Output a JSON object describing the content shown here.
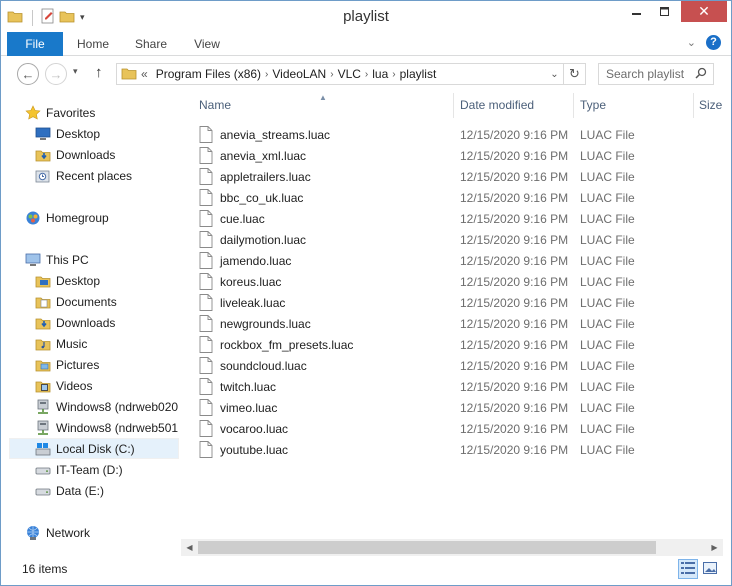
{
  "window": {
    "title": "playlist"
  },
  "ribbon": {
    "tabs": [
      "File",
      "Home",
      "Share",
      "View"
    ]
  },
  "navbar": {
    "breadcrumb_prefix": "«",
    "breadcrumbs": [
      "Program Files (x86)",
      "VideoLAN",
      "VLC",
      "lua",
      "playlist"
    ],
    "search_placeholder": "Search playlist"
  },
  "navpane": {
    "items": [
      {
        "label": "Favorites",
        "icon": "star-icon",
        "level": 0
      },
      {
        "label": "Desktop",
        "icon": "desktop-icon",
        "level": 1
      },
      {
        "label": "Downloads",
        "icon": "downloads-folder-icon",
        "level": 1
      },
      {
        "label": "Recent places",
        "icon": "recent-places-icon",
        "level": 1
      },
      {
        "label": "Homegroup",
        "icon": "homegroup-icon",
        "level": 0
      },
      {
        "label": "This PC",
        "icon": "computer-icon",
        "level": 0
      },
      {
        "label": "Desktop",
        "icon": "desktop-folder-icon",
        "level": 1
      },
      {
        "label": "Documents",
        "icon": "documents-folder-icon",
        "level": 1
      },
      {
        "label": "Downloads",
        "icon": "downloads-folder-icon",
        "level": 1
      },
      {
        "label": "Music",
        "icon": "music-folder-icon",
        "level": 1
      },
      {
        "label": "Pictures",
        "icon": "pictures-folder-icon",
        "level": 1
      },
      {
        "label": "Videos",
        "icon": "videos-folder-icon",
        "level": 1
      },
      {
        "label": "Windows8 (ndrweb020",
        "icon": "network-drive-icon",
        "level": 1
      },
      {
        "label": "Windows8 (ndrweb501",
        "icon": "network-drive-icon",
        "level": 1
      },
      {
        "label": "Local Disk (C:)",
        "icon": "local-disk-icon",
        "level": 1,
        "selected": true
      },
      {
        "label": "IT-Team (D:)",
        "icon": "drive-icon",
        "level": 1
      },
      {
        "label": "Data (E:)",
        "icon": "drive-icon",
        "level": 1
      },
      {
        "label": "Network",
        "icon": "network-icon",
        "level": 0
      }
    ]
  },
  "columns": {
    "name": "Name",
    "date": "Date modified",
    "type": "Type",
    "size": "Size"
  },
  "files": [
    {
      "name": "anevia_streams.luac",
      "date": "12/15/2020 9:16 PM",
      "type": "LUAC File"
    },
    {
      "name": "anevia_xml.luac",
      "date": "12/15/2020 9:16 PM",
      "type": "LUAC File"
    },
    {
      "name": "appletrailers.luac",
      "date": "12/15/2020 9:16 PM",
      "type": "LUAC File"
    },
    {
      "name": "bbc_co_uk.luac",
      "date": "12/15/2020 9:16 PM",
      "type": "LUAC File"
    },
    {
      "name": "cue.luac",
      "date": "12/15/2020 9:16 PM",
      "type": "LUAC File"
    },
    {
      "name": "dailymotion.luac",
      "date": "12/15/2020 9:16 PM",
      "type": "LUAC File"
    },
    {
      "name": "jamendo.luac",
      "date": "12/15/2020 9:16 PM",
      "type": "LUAC File"
    },
    {
      "name": "koreus.luac",
      "date": "12/15/2020 9:16 PM",
      "type": "LUAC File"
    },
    {
      "name": "liveleak.luac",
      "date": "12/15/2020 9:16 PM",
      "type": "LUAC File"
    },
    {
      "name": "newgrounds.luac",
      "date": "12/15/2020 9:16 PM",
      "type": "LUAC File"
    },
    {
      "name": "rockbox_fm_presets.luac",
      "date": "12/15/2020 9:16 PM",
      "type": "LUAC File"
    },
    {
      "name": "soundcloud.luac",
      "date": "12/15/2020 9:16 PM",
      "type": "LUAC File"
    },
    {
      "name": "twitch.luac",
      "date": "12/15/2020 9:16 PM",
      "type": "LUAC File"
    },
    {
      "name": "vimeo.luac",
      "date": "12/15/2020 9:16 PM",
      "type": "LUAC File"
    },
    {
      "name": "vocaroo.luac",
      "date": "12/15/2020 9:16 PM",
      "type": "LUAC File"
    },
    {
      "name": "youtube.luac",
      "date": "12/15/2020 9:16 PM",
      "type": "LUAC File"
    }
  ],
  "status": {
    "count": "16 items"
  },
  "colors": {
    "accent": "#1979ca",
    "close": "#c75050",
    "folder": "#e8c35a",
    "selected": "#e5f1fb"
  }
}
